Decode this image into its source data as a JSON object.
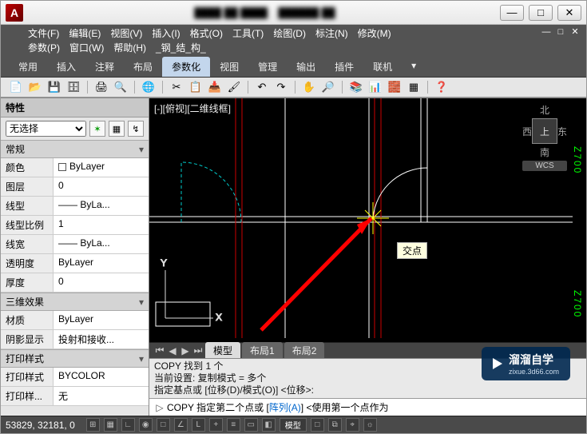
{
  "title_bar": {
    "app_letter": "A",
    "blur1": "████ ██ ████",
    "blur2": "██████ ██"
  },
  "win_buttons": {
    "min": "—",
    "max": "□",
    "close": "✕"
  },
  "menu": {
    "row1": [
      "文件(F)",
      "编辑(E)",
      "视图(V)",
      "插入(I)",
      "格式(O)",
      "工具(T)",
      "绘图(D)",
      "标注(N)",
      "修改(M)"
    ],
    "row2": [
      "参数(P)",
      "窗口(W)",
      "帮助(H)",
      "_钢_结_构_"
    ],
    "sub_min": "—",
    "sub_max": "□",
    "sub_close": "✕"
  },
  "ribbon": {
    "tabs": [
      "常用",
      "插入",
      "注释",
      "布局",
      "参数化",
      "视图",
      "管理",
      "输出",
      "插件",
      "联机"
    ],
    "active": 4,
    "expand": "▾"
  },
  "left": {
    "title": "特性",
    "select_value": "无选择",
    "sections": [
      {
        "name": "常规",
        "rows": [
          {
            "k": "颜色",
            "v": "ByLayer",
            "swatch": "#fff"
          },
          {
            "k": "图层",
            "v": "0"
          },
          {
            "k": "线型",
            "v": "—— ByLa..."
          },
          {
            "k": "线型比例",
            "v": "1"
          },
          {
            "k": "线宽",
            "v": "—— ByLa..."
          },
          {
            "k": "透明度",
            "v": "ByLayer"
          },
          {
            "k": "厚度",
            "v": "0"
          }
        ]
      },
      {
        "name": "三维效果",
        "rows": [
          {
            "k": "材质",
            "v": "ByLayer"
          },
          {
            "k": "阴影显示",
            "v": "投射和接收..."
          }
        ]
      },
      {
        "name": "打印样式",
        "rows": [
          {
            "k": "打印样式",
            "v": "BYCOLOR"
          },
          {
            "k": "打印样...",
            "v": "无"
          }
        ]
      }
    ]
  },
  "canvas": {
    "view_label": "[-][俯视][二维线框]",
    "cube": {
      "n": "北",
      "s": "南",
      "e": "东",
      "w": "西",
      "top": "上"
    },
    "wcs": "WCS",
    "vert1": "Z700",
    "vert2": "Z700",
    "tooltip": "交点"
  },
  "sheets": {
    "tabs": [
      "模型",
      "布局1",
      "布局2"
    ],
    "active": 0
  },
  "cmd": {
    "history": [
      "COPY 找到 1 个",
      "当前设置:  复制模式 = 多个",
      "指定基点或 [位移(D)/模式(O)] <位移>:"
    ],
    "prompt_icon": "▷",
    "input_pre": "COPY 指定第二个点或 [",
    "input_hl": "阵列(A)",
    "input_post": "] <使用第一个点作为"
  },
  "status": {
    "coords": "53829, 32181, 0",
    "model_btn": "模型"
  },
  "watermark": {
    "brand": "溜溜自学",
    "sub": "zixue.3d66.com"
  }
}
